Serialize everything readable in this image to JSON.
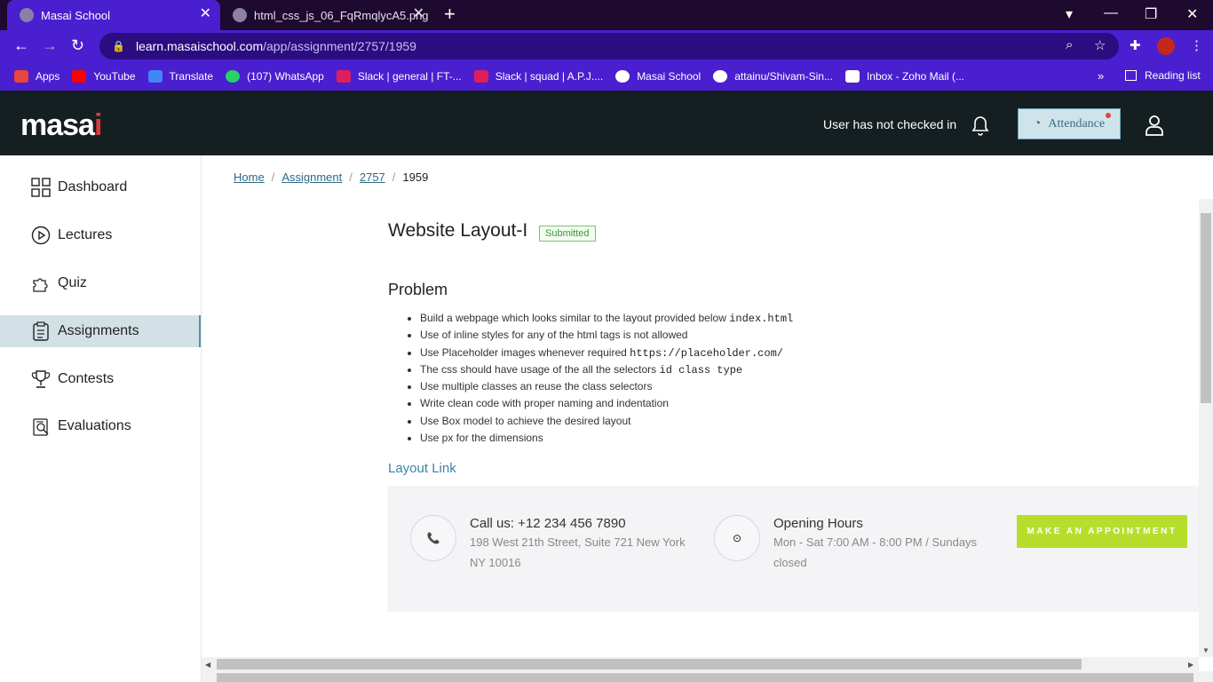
{
  "browser": {
    "tabs": [
      {
        "title": "Masai School",
        "active": true
      },
      {
        "title": "html_css_js_06_FqRmqlycA5.png",
        "active": false
      }
    ],
    "new_tab": "+",
    "window_controls": [
      "▾",
      "—",
      "❐",
      "✕"
    ],
    "url_domain": "learn.masaischool.com",
    "url_path": "/app/assignment/2757/1959",
    "bookmarks": [
      {
        "label": "Apps",
        "icon": "apps-grid-icon",
        "color": "#e8453c"
      },
      {
        "label": "YouTube",
        "icon": "youtube-icon",
        "color": "#ff0000"
      },
      {
        "label": "Translate",
        "icon": "translate-icon",
        "color": "#4285f4"
      },
      {
        "label": "(107) WhatsApp",
        "icon": "whatsapp-icon",
        "color": "#25d366"
      },
      {
        "label": "Slack | general | FT-...",
        "icon": "slack-icon",
        "color": "#e01e5a"
      },
      {
        "label": "Slack | squad | A.P.J....",
        "icon": "slack-icon",
        "color": "#e01e5a"
      },
      {
        "label": "Masai School",
        "icon": "globe-icon",
        "color": "#ffffff"
      },
      {
        "label": "attainu/Shivam-Sin...",
        "icon": "github-icon",
        "color": "#ffffff"
      },
      {
        "label": "Inbox - Zoho Mail (...",
        "icon": "zoho-mail-icon",
        "color": "#ffffff"
      }
    ],
    "bookmarks_overflow": "»",
    "reading_list": "Reading list"
  },
  "header": {
    "logo_prefix": "masa",
    "logo_i": "i",
    "checkin_status": "User has not checked in",
    "attendance_label": "Attendance"
  },
  "sidebar": {
    "items": [
      {
        "label": "Dashboard",
        "icon": "dashboard-grid-icon",
        "active": false
      },
      {
        "label": "Lectures",
        "icon": "play-circle-icon",
        "active": false
      },
      {
        "label": "Quiz",
        "icon": "puzzle-icon",
        "active": false
      },
      {
        "label": "Assignments",
        "icon": "clipboard-icon",
        "active": true
      },
      {
        "label": "Contests",
        "icon": "trophy-icon",
        "active": false
      },
      {
        "label": "Evaluations",
        "icon": "evaluation-icon",
        "active": false
      }
    ]
  },
  "breadcrumb": {
    "home": "Home",
    "assignment": "Assignment",
    "id": "2757",
    "current": "1959",
    "separator": "/"
  },
  "assignment": {
    "title": "Website Layout-I",
    "status": "Submitted",
    "problem_heading": "Problem",
    "requirements": [
      {
        "text": "Build a webpage which looks similar to the layout provided below ",
        "code": "index.html"
      },
      {
        "text": "Use of inline styles for any of the html tags is not allowed",
        "code": ""
      },
      {
        "text": "Use Placeholder images whenever required ",
        "code": "https://placeholder.com/"
      },
      {
        "text": "The css should have usage of the all the selectors ",
        "code": "id class type"
      },
      {
        "text": "Use multiple classes an reuse the class selectors",
        "code": ""
      },
      {
        "text": "Write clean code with proper naming and indentation",
        "code": ""
      },
      {
        "text": "Use Box model to achieve the desired layout",
        "code": ""
      },
      {
        "text": "Use px for the dimensions",
        "code": ""
      }
    ],
    "layout_link": "Layout Link"
  },
  "preview": {
    "call_title": "Call us: +12 234 456 7890",
    "call_line1": "198 West 21th Street, Suite 721 New York",
    "call_line2": "NY 10016",
    "hours_title": "Opening Hours",
    "hours_line1": "Mon - Sat 7:00 AM - 8:00 PM / Sundays",
    "hours_line2": "closed",
    "button": "MAKE AN APPOINTMENT",
    "button_color": "#b7de2c"
  },
  "colors": {
    "browser_chrome": "#4a1fd0",
    "tabstrip": "#1e0a2e",
    "header_bg": "#151e20",
    "active_sidebar": "#d2e1e5",
    "link": "#2e6a86"
  }
}
